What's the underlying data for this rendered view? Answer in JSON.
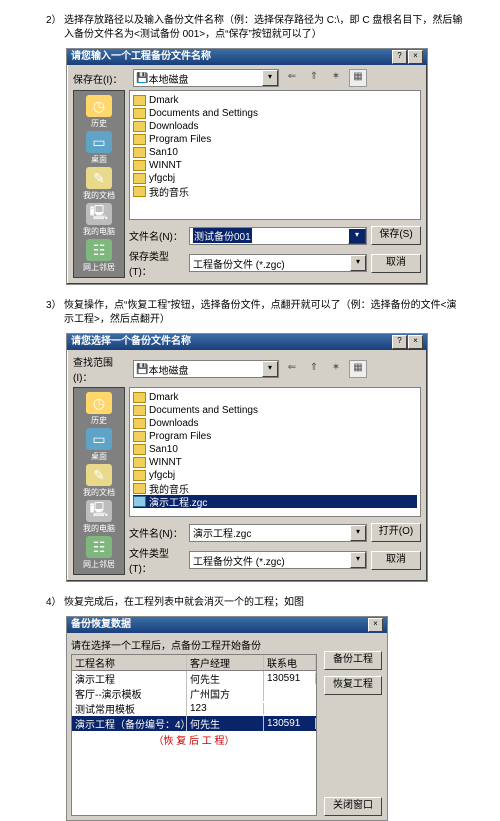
{
  "step2": {
    "num": "2）",
    "text": "选择存放路径以及输入备份文件名称（例：选择保存路径为 C:\\，即 C 盘根名目下，然后输入备份文件名为<测试备份 001>，点“保存”按钮就可以了）"
  },
  "step3": {
    "num": "3）",
    "text": "恢复操作，点“恢复工程”按钮，选择备份文件，点翻开就可以了（例：选择备份的文件<演示工程>，然后点翻开）"
  },
  "step4": {
    "num": "4）",
    "text": "恢复完成后，在工程列表中就会消灭一个的工程；如图"
  },
  "dlg1": {
    "title": "请您输入一个工程备份文件名称",
    "saveInLbl": "保存在(I)：",
    "location": "本地磁盘",
    "side": [
      "历史",
      "桌面",
      "我的文档",
      "我的电脑",
      "网上邻居"
    ],
    "files": [
      "Dmark",
      "Documents and Settings",
      "Downloads",
      "Program Files",
      "San10",
      "WINNT",
      "yfgcbj",
      "我的音乐"
    ],
    "fnLbl": "文件名(N)：",
    "fn": "测试备份001",
    "ftLbl": "保存类型(T)：",
    "ft": "工程备份文件 (*.zgc)",
    "save": "保存(S)",
    "cancel": "取消"
  },
  "dlg2": {
    "title": "请您选择一个备份文件名称",
    "lookInLbl": "查找范围(I)：",
    "location": "本地磁盘",
    "side": [
      "历史",
      "桌面",
      "我的文档",
      "我的电脑",
      "网上邻居"
    ],
    "files": [
      "Dmark",
      "Documents and Settings",
      "Downloads",
      "Program Files",
      "San10",
      "WINNT",
      "yfgcbj",
      "我的音乐"
    ],
    "selFile": "演示工程.zgc",
    "fnLbl": "文件名(N)：",
    "fn": "演示工程.zgc",
    "ftLbl": "文件类型(T)：",
    "ft": "工程备份文件 (*.zgc)",
    "open": "打开(O)",
    "cancel": "取消"
  },
  "win3": {
    "title": "备份恢复数据",
    "hint": "请在选择一个工程后，点备份工程开始备份",
    "cols": [
      "工程名称",
      "客户经理",
      "联系电"
    ],
    "rows": [
      [
        "演示工程",
        "何先生",
        "130591"
      ],
      [
        "客厅--演示模板",
        "广州国方",
        ""
      ],
      [
        "测试常用模板",
        "123",
        ""
      ],
      [
        "演示工程（备份编号：4）",
        "何先生",
        "130591"
      ]
    ],
    "note": "（恢 复 后 工 程）",
    "btnBackup": "备份工程",
    "btnRestore": "恢复工程",
    "btnClose": "关闭窗口"
  }
}
